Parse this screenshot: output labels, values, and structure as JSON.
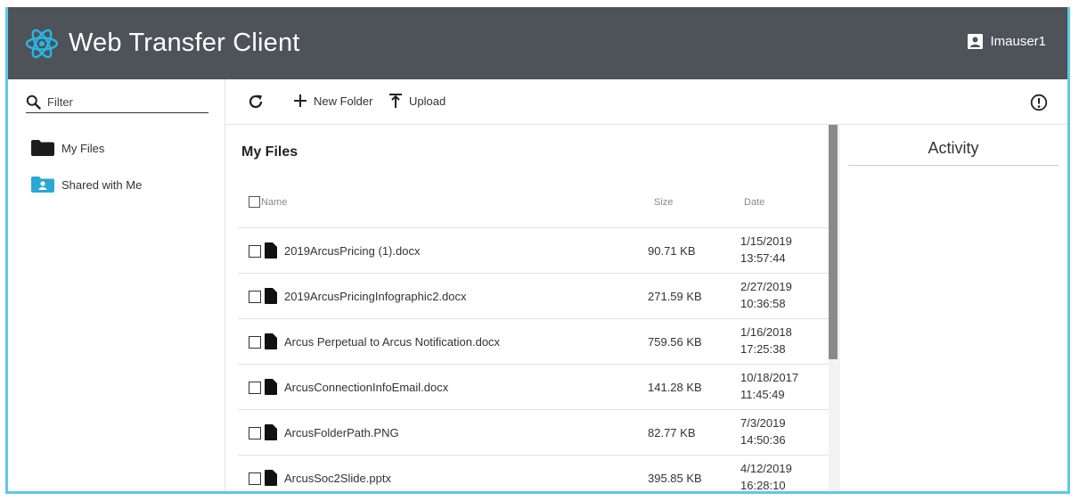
{
  "app": {
    "title": "Web Transfer Client",
    "username": "Imauser1"
  },
  "colors": {
    "header_bg": "#4d5358",
    "accent": "#5fc8e8",
    "shared_folder": "#2aa7d6"
  },
  "sidebar": {
    "filter_placeholder": "Filter",
    "items": [
      {
        "label": "My Files",
        "icon": "folder-icon"
      },
      {
        "label": "Shared with Me",
        "icon": "shared-folder-icon"
      }
    ]
  },
  "toolbar": {
    "new_folder_label": "New Folder",
    "upload_label": "Upload"
  },
  "main": {
    "title": "My Files",
    "columns": {
      "name": "Name",
      "size": "Size",
      "date": "Date"
    },
    "files": [
      {
        "name": "2019ArcusPricing (1).docx",
        "size": "90.71 KB",
        "date": "1/15/2019",
        "time": "13:57:44"
      },
      {
        "name": "2019ArcusPricingInfographic2.docx",
        "size": "271.59 KB",
        "date": "2/27/2019",
        "time": "10:36:58"
      },
      {
        "name": "Arcus Perpetual to Arcus Notification.docx",
        "size": "759.56 KB",
        "date": "1/16/2018",
        "time": "17:25:38"
      },
      {
        "name": "ArcusConnectionInfoEmail.docx",
        "size": "141.28 KB",
        "date": "10/18/2017",
        "time": "11:45:49"
      },
      {
        "name": "ArcusFolderPath.PNG",
        "size": "82.77 KB",
        "date": "7/3/2019",
        "time": "14:50:36"
      },
      {
        "name": "ArcusSoc2Slide.pptx",
        "size": "395.85 KB",
        "date": "4/12/2019",
        "time": "16:28:10"
      }
    ]
  },
  "activity": {
    "title": "Activity"
  }
}
